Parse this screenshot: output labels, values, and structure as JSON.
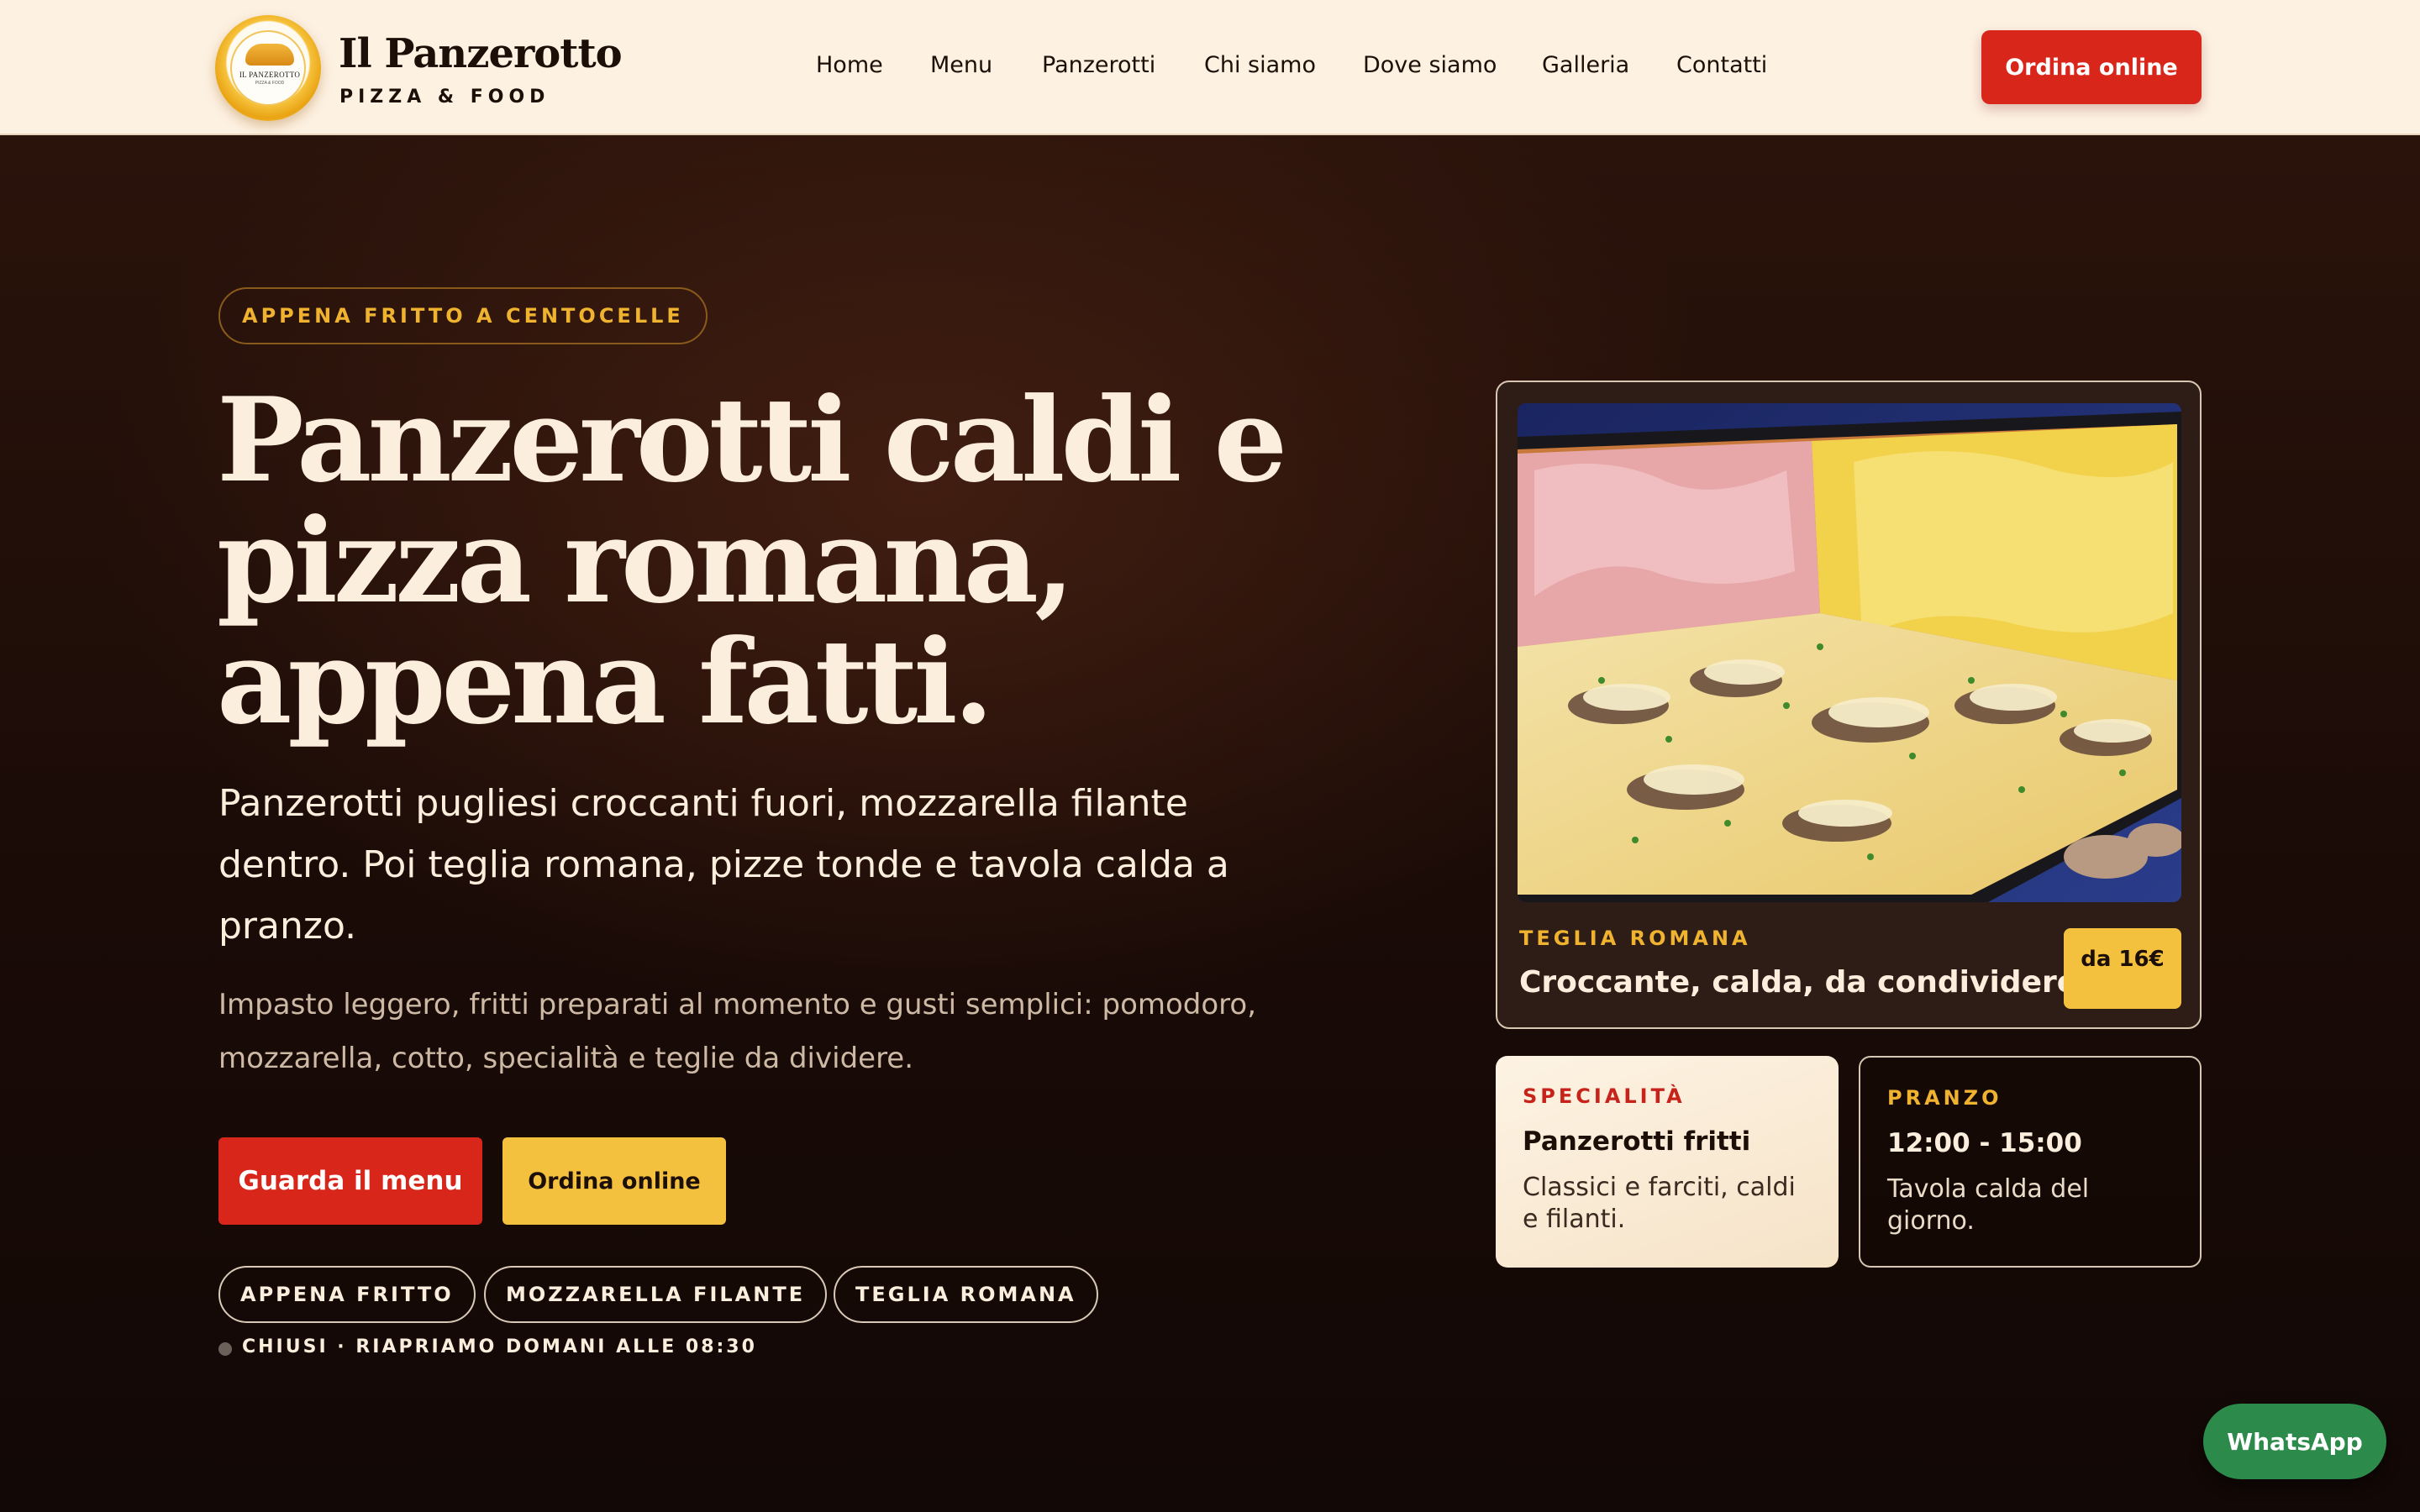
{
  "header": {
    "brand_name": "Il Panzerotto",
    "brand_sub": "PIZZA & FOOD",
    "logo_text": "IL PANZEROTTO",
    "logo_sub": "PIZZA & FOOD",
    "nav": [
      "Home",
      "Menu",
      "Panzerotti",
      "Chi siamo",
      "Dove siamo",
      "Galleria",
      "Contatti"
    ],
    "cta": "Ordina online"
  },
  "hero": {
    "eyebrow": "APPENA FRITTO A CENTOCELLE",
    "headline_lines": [
      "Panzerotti caldi e",
      "pizza romana,",
      "appena fatti."
    ],
    "lead": "Panzerotti pugliesi croccanti fuori, mozzarella filante dentro. Poi teglia romana, pizze tonde e tavola calda a pranzo.",
    "description": "Impasto leggero, fritti preparati al momento e gusti semplici: pomodoro, mozzarella, cotto, specialità e teglie da dividere.",
    "buttons": {
      "menu": "Guarda il menu",
      "order": "Ordina online"
    },
    "chips": [
      "APPENA FRITTO",
      "MOZZARELLA FILANTE",
      "TEGLIA ROMANA"
    ],
    "status": "CHIUSI · RIAPRIAMO DOMANI ALLE 08:30"
  },
  "feature": {
    "tag": "TEGLIA ROMANA",
    "title": "Croccante, calda, da condividere.",
    "price": "da 16€"
  },
  "cards": [
    {
      "tag": "SPECIALITÀ",
      "title": "Panzerotti fritti",
      "body": "Classici e farciti, caldi e filanti."
    },
    {
      "tag": "PRANZO",
      "title": "12:00 - 15:00",
      "body": "Tavola calda del giorno."
    }
  ],
  "whatsapp": "WhatsApp",
  "colors": {
    "header_bg": "#fdf1e2",
    "hero_bg": "#1a0b07",
    "accent_red": "#d8261b",
    "accent_yellow": "#f4c13e",
    "tag_gold": "#f0b330",
    "whatsapp_green": "#2c8a4b",
    "text_cream": "#fbeedd"
  }
}
